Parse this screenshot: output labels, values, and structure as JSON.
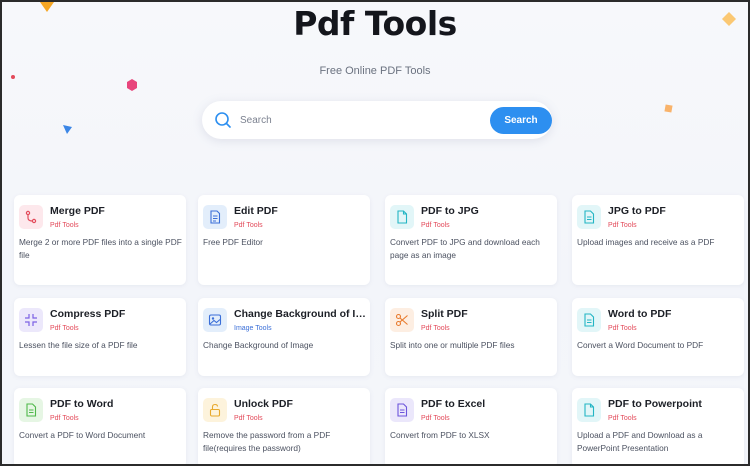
{
  "page": {
    "title": "Pdf Tools",
    "subtitle": "Free Online PDF Tools"
  },
  "search": {
    "placeholder": "Search",
    "button_label": "Search"
  },
  "colors": {
    "accent": "#2d8ff0",
    "tag_red": "#e34a5a",
    "tag_blue": "#3b6fd8"
  },
  "tools": [
    {
      "title": "Merge PDF",
      "tag": "Pdf Tools",
      "description": "Merge 2 or more PDF files into a single PDF file",
      "icon": "merge-icon"
    },
    {
      "title": "Edit PDF",
      "tag": "Pdf Tools",
      "description": "Free PDF Editor",
      "icon": "document-edit-icon"
    },
    {
      "title": "PDF to JPG",
      "tag": "Pdf Tools",
      "description": "Convert PDF to JPG and download each page as an image",
      "icon": "file-icon"
    },
    {
      "title": "JPG to PDF",
      "tag": "Pdf Tools",
      "description": "Upload images and receive as a PDF",
      "icon": "file-text-icon"
    },
    {
      "title": "Compress PDF",
      "tag": "Pdf Tools",
      "description": "Lessen the file size of a PDF file",
      "icon": "compress-icon"
    },
    {
      "title": "Change Background of Image",
      "tag": "Image Tools",
      "description": "Change Background of Image",
      "icon": "image-icon"
    },
    {
      "title": "Split PDF",
      "tag": "Pdf Tools",
      "description": "Split into one or multiple PDF files",
      "icon": "scissors-icon"
    },
    {
      "title": "Word to PDF",
      "tag": "Pdf Tools",
      "description": "Convert a Word Document to PDF",
      "icon": "file-text-icon"
    },
    {
      "title": "PDF to Word",
      "tag": "Pdf Tools",
      "description": "Convert a PDF to Word Document",
      "icon": "file-text-icon"
    },
    {
      "title": "Unlock PDF",
      "tag": "Pdf Tools",
      "description": "Remove the password from a PDF file(requires the password)",
      "icon": "unlock-icon"
    },
    {
      "title": "PDF to Excel",
      "tag": "Pdf Tools",
      "description": "Convert from PDF to XLSX",
      "icon": "file-text-icon"
    },
    {
      "title": "PDF to Powerpoint",
      "tag": "Pdf Tools",
      "description": "Upload a PDF and Download as a PowerPoint Presentation",
      "icon": "file-icon"
    }
  ]
}
